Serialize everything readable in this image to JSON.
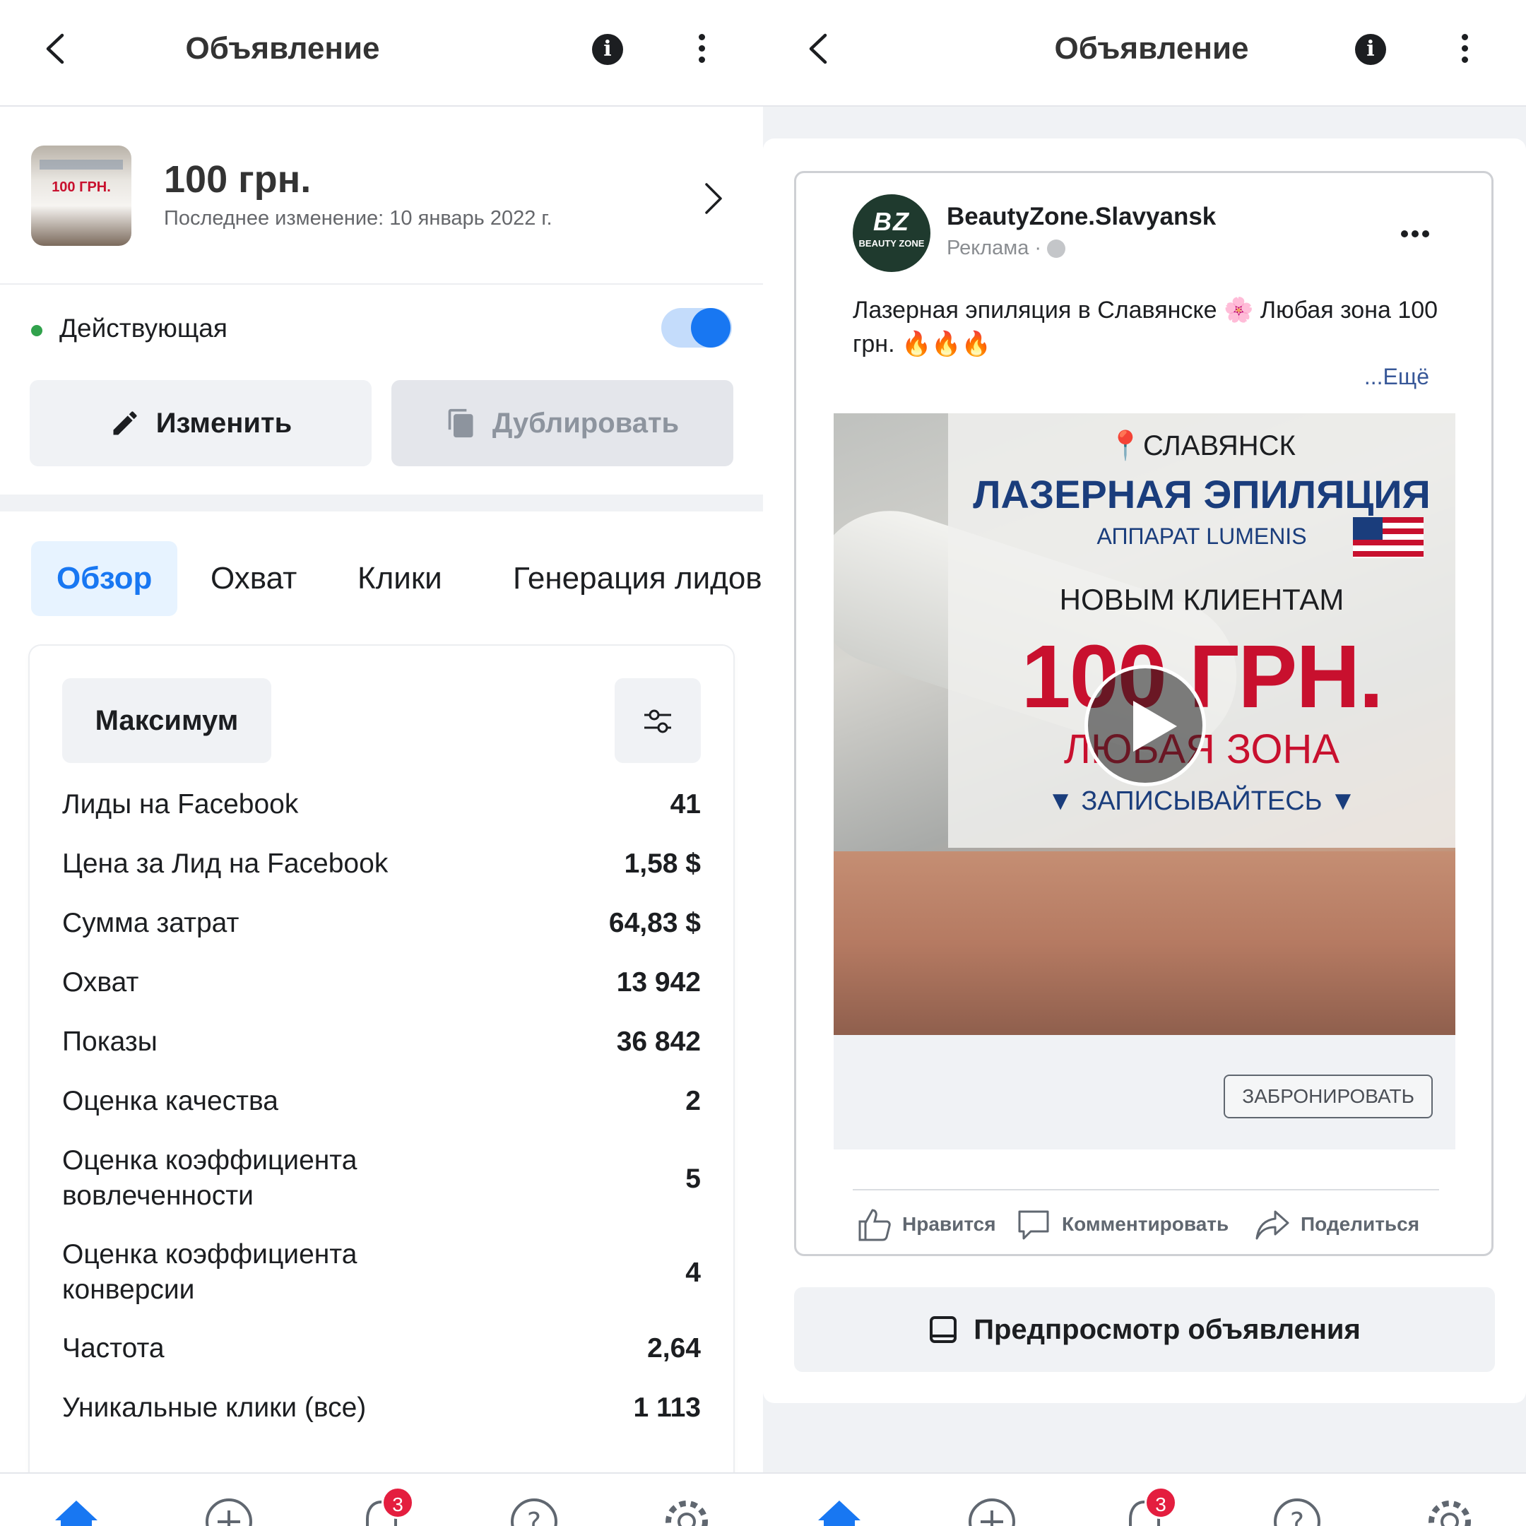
{
  "header": {
    "title": "Объявление",
    "info_icon": "info-icon",
    "more_icon": "more-vertical-icon"
  },
  "ad": {
    "thumb_text": "100 ГРН.",
    "price": "100 грн.",
    "last_modified": "Последнее изменение: 10 январь 2022 г."
  },
  "status": {
    "label": "Действующая",
    "active": true
  },
  "actions": {
    "edit": "Изменить",
    "duplicate": "Дублировать"
  },
  "tabs": [
    {
      "label": "Обзор",
      "active": true
    },
    {
      "label": "Охват",
      "active": false
    },
    {
      "label": "Клики",
      "active": false
    },
    {
      "label": "Генерация лидов",
      "active": false
    }
  ],
  "metrics": {
    "period_button": "Максимум",
    "rows": [
      {
        "label": "Лиды на Facebook",
        "value": "41"
      },
      {
        "label": "Цена за Лид на Facebook",
        "value": "1,58 $"
      },
      {
        "label": "Сумма затрат",
        "value": "64,83 $"
      },
      {
        "label": "Охват",
        "value": "13 942"
      },
      {
        "label": "Показы",
        "value": "36 842"
      },
      {
        "label": "Оценка качества",
        "value": "2"
      },
      {
        "label": "Оценка коэффициента вовлеченности",
        "value": "5"
      },
      {
        "label": "Оценка коэффициента конверсии",
        "value": "4"
      },
      {
        "label": "Частота",
        "value": "2,64"
      },
      {
        "label": "Уникальные клики (все)",
        "value": "1 113"
      }
    ]
  },
  "nav": {
    "badge_count": "3",
    "items": [
      "home-icon",
      "plus-circle-icon",
      "bell-icon",
      "help-icon",
      "gear-icon"
    ]
  },
  "post": {
    "avatar_line1": "BZ",
    "avatar_line2": "BEAUTY ZONE",
    "page_name": "BeautyZone.Slavyansk",
    "sponsored": "Реклама · ",
    "text": "Лазерная эпиляция в Славянске 🌸 Любая зона 100 грн. 🔥🔥🔥",
    "see_more": "...Ещё",
    "media": {
      "city": "СЛАВЯНСК",
      "title": "ЛАЗЕРНАЯ ЭПИЛЯЦИЯ",
      "device": "АППАРАТ LUMENIS",
      "new_clients": "НОВЫМ КЛИЕНТАМ",
      "price": "100 ГРН.",
      "zone": "ЛЮБАЯ ЗОНА",
      "signup": "ЗАПИСЫВАЙТЕСЬ"
    },
    "cta": "ЗАБРОНИРОВАТЬ",
    "like": "Нравится",
    "comment": "Комментировать",
    "share": "Поделиться"
  },
  "preview_button": "Предпросмотр объявления",
  "colors": {
    "accent": "#1877f2",
    "status_green": "#31a24c",
    "badge_red": "#e41e3f"
  }
}
